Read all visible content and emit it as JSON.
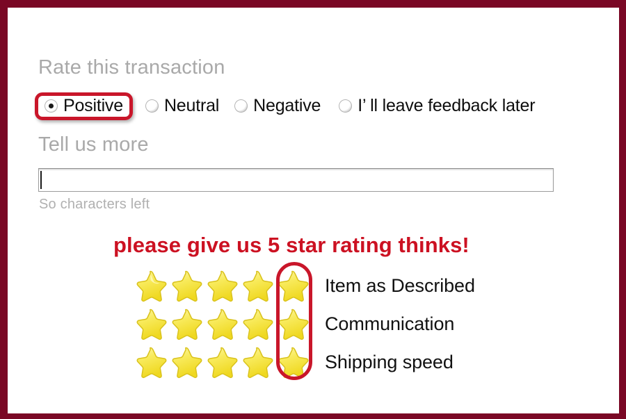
{
  "theme": {
    "frame_color": "#7a0825",
    "heading_color": "#a9a9a9",
    "highlight_red": "#c9162a",
    "plea_red": "#cc1122",
    "star_fill": "#f5e43c",
    "text_color": "#111111",
    "page_background": "#ffffff"
  },
  "rate_section": {
    "heading": "Rate this transaction",
    "options": [
      {
        "label": "Positive",
        "checked": true,
        "highlighted": true
      },
      {
        "label": "Neutral",
        "checked": false,
        "highlighted": false
      },
      {
        "label": "Negative",
        "checked": false,
        "highlighted": false
      },
      {
        "label": "I’  ll leave feedback later",
        "checked": false,
        "highlighted": false
      }
    ]
  },
  "comment_section": {
    "heading": "Tell us more",
    "input_value": "",
    "input_placeholder": "",
    "characters_left_note": "So characters left"
  },
  "plea": {
    "text": "please give us 5 star rating thinks!"
  },
  "ratings": {
    "star_count": 5,
    "highlighted_star_index": 5,
    "rows": [
      {
        "label": "Item as Described",
        "stars": 5
      },
      {
        "label": "Communication",
        "stars": 5
      },
      {
        "label": "Shipping speed",
        "stars": 5
      }
    ]
  }
}
